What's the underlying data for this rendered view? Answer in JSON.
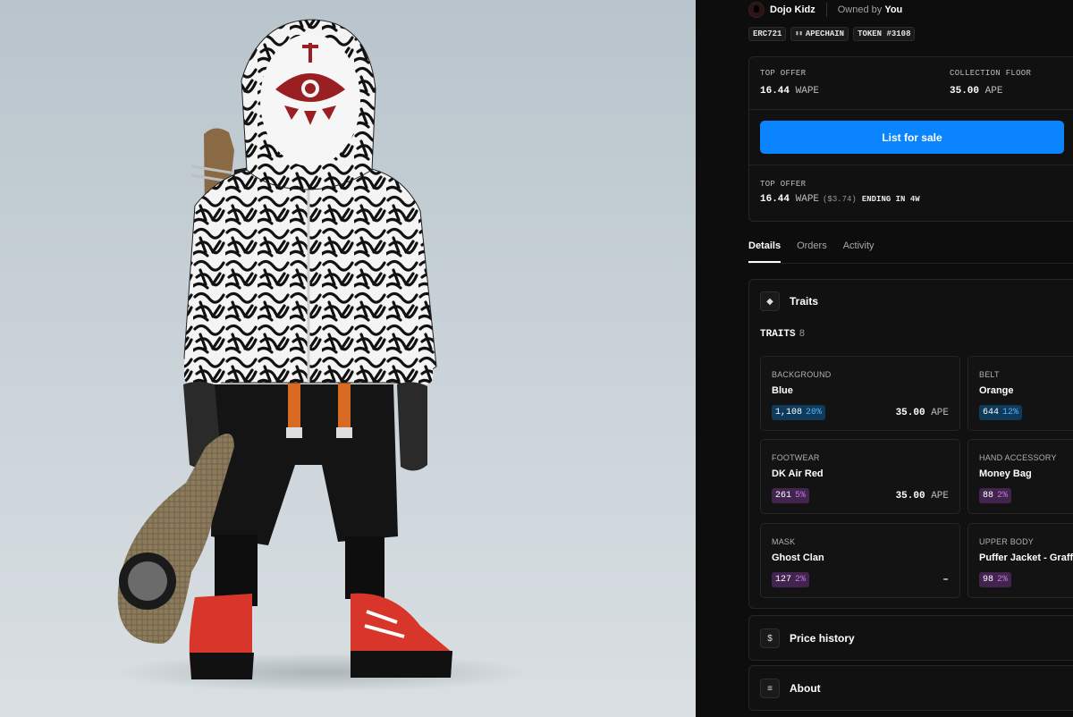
{
  "header": {
    "collection_name": "Dojo Kidz",
    "owned_prefix": "Owned by",
    "owner": "You"
  },
  "badges": [
    {
      "label": "ERC721"
    },
    {
      "icon": "apechain-icon",
      "label": "APECHAIN"
    },
    {
      "label": "TOKEN #3108"
    }
  ],
  "offer_card": {
    "top_offer_label": "TOP OFFER",
    "top_offer_value": "16.44",
    "top_offer_unit": "WAPE",
    "floor_label": "COLLECTION FLOOR",
    "floor_value": "35.00",
    "floor_unit": "APE",
    "list_button": "List for sale",
    "bottom_offer_label": "TOP OFFER",
    "bottom_offer_value": "16.44",
    "bottom_offer_unit": "WAPE",
    "bottom_offer_usd": "($3.74)",
    "ending": "ENDING IN 4W"
  },
  "tabs": [
    {
      "label": "Details",
      "active": true
    },
    {
      "label": "Orders",
      "active": false
    },
    {
      "label": "Activity",
      "active": false
    }
  ],
  "traits_section": {
    "title": "Traits",
    "icon": "diamond-icon",
    "count_label": "TRAITS",
    "count": "8",
    "items": [
      {
        "category": "BACKGROUND",
        "value": "Blue",
        "count": "1,108",
        "pct": "20%",
        "color": "blue",
        "price": "35.00",
        "price_unit": "APE"
      },
      {
        "category": "BELT",
        "value": "Orange",
        "count": "644",
        "pct": "12%",
        "color": "blue",
        "price": "",
        "price_unit": ""
      },
      {
        "category": "FOOTWEAR",
        "value": "DK Air Red",
        "count": "261",
        "pct": "5%",
        "color": "purple",
        "price": "35.00",
        "price_unit": "APE"
      },
      {
        "category": "HAND ACCESSORY",
        "value": "Money Bag",
        "count": "88",
        "pct": "2%",
        "color": "purple",
        "price": "",
        "price_unit": ""
      },
      {
        "category": "MASK",
        "value": "Ghost Clan",
        "count": "127",
        "pct": "2%",
        "color": "purple",
        "price": "–",
        "price_unit": ""
      },
      {
        "category": "UPPER BODY",
        "value": "Puffer Jacket - Graffiti",
        "count": "98",
        "pct": "2%",
        "color": "purple",
        "price": "",
        "price_unit": ""
      }
    ]
  },
  "price_history": {
    "title": "Price history",
    "icon": "dollar-icon"
  },
  "about": {
    "title": "About",
    "icon": "text-lines-icon"
  },
  "colors": {
    "accent": "#0a84ff",
    "panel_bg": "#0d0d0d",
    "rarity_blue": "#0e3a5c",
    "rarity_purple": "#42244f"
  }
}
